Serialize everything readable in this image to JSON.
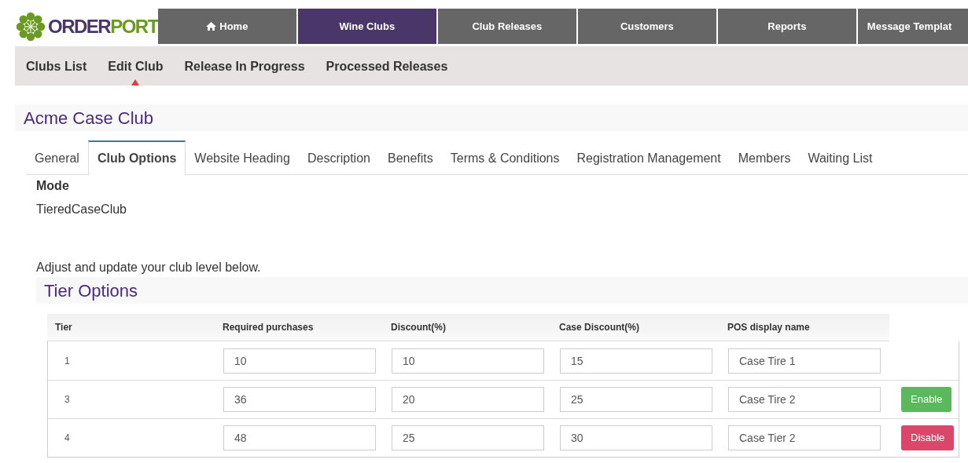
{
  "logo": {
    "part_1": "ORDER",
    "part_2": "PORT"
  },
  "top_nav": [
    {
      "label": "Home",
      "icon": true,
      "selected": false
    },
    {
      "label": "Wine Clubs",
      "icon": false,
      "selected": true
    },
    {
      "label": "Club Releases",
      "icon": false,
      "selected": false
    },
    {
      "label": "Customers",
      "icon": false,
      "selected": false
    },
    {
      "label": "Reports",
      "icon": false,
      "selected": false
    },
    {
      "label": "Message Templat",
      "icon": false,
      "selected": false
    }
  ],
  "sub_nav": [
    {
      "label": "Clubs List",
      "selected": false
    },
    {
      "label": "Edit Club",
      "selected": true
    },
    {
      "label": "Release In Progress",
      "selected": false
    },
    {
      "label": "Processed Releases",
      "selected": false
    }
  ],
  "club_title": "Acme Case Club",
  "tabs": [
    {
      "label": "General",
      "selected": false
    },
    {
      "label": "Club Options",
      "selected": true
    },
    {
      "label": "Website Heading",
      "selected": false
    },
    {
      "label": "Description",
      "selected": false
    },
    {
      "label": "Benefits",
      "selected": false
    },
    {
      "label": "Terms & Conditions",
      "selected": false
    },
    {
      "label": "Registration Management",
      "selected": false
    },
    {
      "label": "Members",
      "selected": false
    },
    {
      "label": "Waiting List",
      "selected": false
    }
  ],
  "mode": {
    "label": "Mode",
    "value": "TieredCaseClub"
  },
  "intro": "Adjust and update your club level below.",
  "tier_options": {
    "title": "Tier Options",
    "columns": [
      "Tier",
      "Required purchases",
      "Discount(%)",
      "Case Discount(%)",
      "POS display name"
    ],
    "rows": [
      {
        "tier": "1",
        "required": "10",
        "discount": "10",
        "case_discount": "15",
        "pos_name": "Case Tire 1"
      },
      {
        "tier": "3",
        "required": "36",
        "discount": "20",
        "case_discount": "25",
        "pos_name": "Case Tire 2",
        "action": {
          "kind": "enable",
          "label": "Enable"
        }
      },
      {
        "tier": "4",
        "required": "48",
        "discount": "25",
        "case_discount": "30",
        "pos_name": "Case Tier 2",
        "action": {
          "kind": "disable",
          "label": "Disable"
        }
      }
    ]
  }
}
